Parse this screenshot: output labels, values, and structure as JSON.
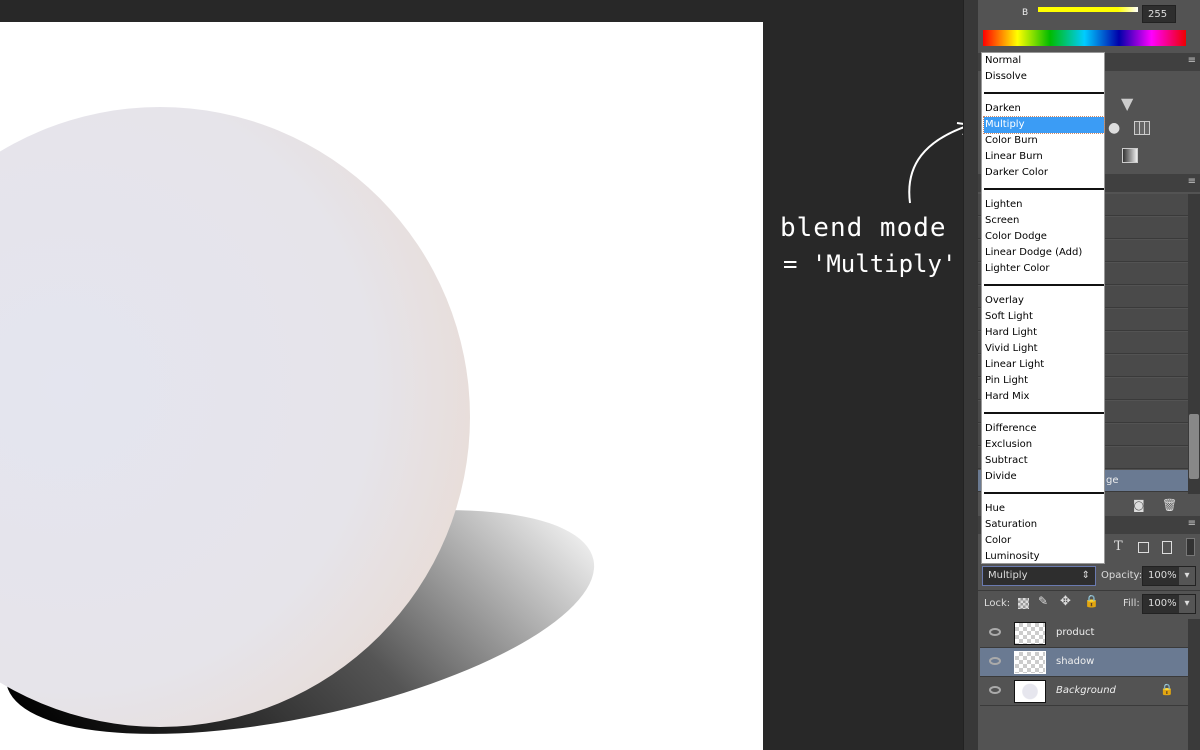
{
  "color_panel": {
    "channel_label": "B",
    "channel_value": "255",
    "slider_color": "#ffff00"
  },
  "blend_menu": {
    "groups": [
      [
        "Normal",
        "Dissolve"
      ],
      [
        "Darken",
        "Multiply",
        "Color Burn",
        "Linear Burn",
        "Darker Color"
      ],
      [
        "Lighten",
        "Screen",
        "Color Dodge",
        "Linear Dodge (Add)",
        "Lighter Color"
      ],
      [
        "Overlay",
        "Soft Light",
        "Hard Light",
        "Vivid Light",
        "Linear Light",
        "Pin Light",
        "Hard Mix"
      ],
      [
        "Difference",
        "Exclusion",
        "Subtract",
        "Divide"
      ],
      [
        "Hue",
        "Saturation",
        "Color",
        "Luminosity"
      ]
    ],
    "selected": "Multiply",
    "highlight_color": "#3b9cf5"
  },
  "history": {
    "partial_label": "ge"
  },
  "layers": {
    "blend_mode": "Multiply",
    "opacity_label": "Opacity:",
    "opacity": "100%",
    "lock_label": "Lock:",
    "fill_label": "Fill:",
    "fill": "100%",
    "items": [
      {
        "name": "product",
        "selected": false
      },
      {
        "name": "shadow",
        "selected": true
      },
      {
        "name": "Background",
        "selected": false,
        "locked": true
      }
    ],
    "selected_color": "#6a7a92"
  },
  "annotation": {
    "line1": "blend mode",
    "line2": "= 'Multiply'"
  }
}
